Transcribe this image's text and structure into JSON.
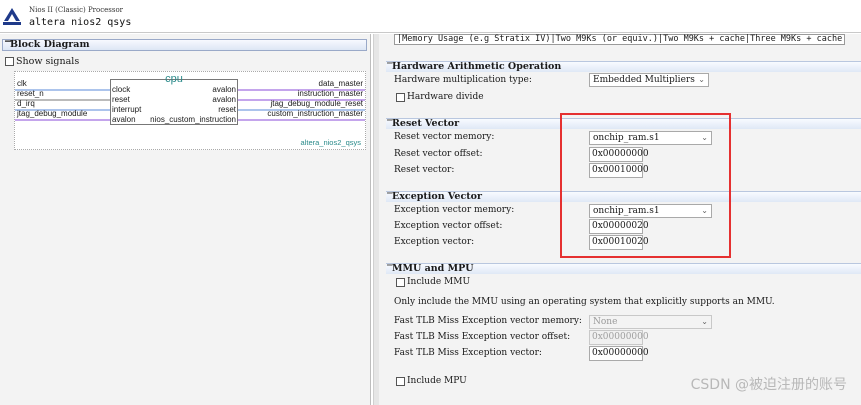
{
  "header": {
    "subtitle": "Nios II (Classic) Processor",
    "title": "altera nios2 qsys"
  },
  "block_diagram": {
    "panel_title": "Block Diagram",
    "show_signals_label": "Show signals",
    "component_name": "cpu",
    "instance_type": "altera_nios2_qsys",
    "left_signals": [
      "clk",
      "reset_n",
      "d_irq",
      "jtag_debug_module"
    ],
    "inner_left_ports": [
      "clock",
      "reset",
      "interrupt",
      "avalon"
    ],
    "inner_right_ports": [
      "avalon",
      "avalon",
      "reset",
      "nios_custom_instruction"
    ],
    "right_signals": [
      "data_master",
      "instruction_master",
      "jtag_debug_module_reset",
      "custom_instruction_master"
    ]
  },
  "memory_usage_row": "|Memory Usage (e.g Stratix IV)|Two M9Ks (or equiv.)|Two M9Ks + cache|Three M9Ks + cache",
  "hardware_arithmetic": {
    "title": "Hardware Arithmetic Operation",
    "mult_label": "Hardware multiplication type:",
    "mult_value": "Embedded Multipliers",
    "divide_label": "Hardware divide"
  },
  "reset_vector": {
    "title": "Reset Vector",
    "memory_label": "Reset vector memory:",
    "memory_value": "onchip_ram.s1",
    "offset_label": "Reset vector offset:",
    "offset_value": "0x00000000",
    "vector_label": "Reset vector:",
    "vector_value": "0x00010000"
  },
  "exception_vector": {
    "title": "Exception Vector",
    "memory_label": "Exception vector memory:",
    "memory_value": "onchip_ram.s1",
    "offset_label": "Exception vector offset:",
    "offset_value": "0x00000020",
    "vector_label": "Exception vector:",
    "vector_value": "0x00010020"
  },
  "mmu_mpu": {
    "title": "MMU and MPU",
    "include_mmu_label": "Include MMU",
    "note": "Only include the MMU using an operating system that explicitly supports an MMU.",
    "tlb_memory_label": "Fast TLB Miss Exception vector memory:",
    "tlb_memory_value": "None",
    "tlb_offset_label": "Fast TLB Miss Exception vector offset:",
    "tlb_offset_value": "0x00000000",
    "tlb_vector_label": "Fast TLB Miss Exception vector:",
    "tlb_vector_value": "0x00000000",
    "include_mpu_label": "Include MPU"
  },
  "watermark": "CSDN @被迫注册的账号",
  "colors": {
    "highlight": "#e53030",
    "section_header": "#dfe8f6",
    "connector": "#8a4bd8",
    "component_name": "#2a8a8a"
  }
}
